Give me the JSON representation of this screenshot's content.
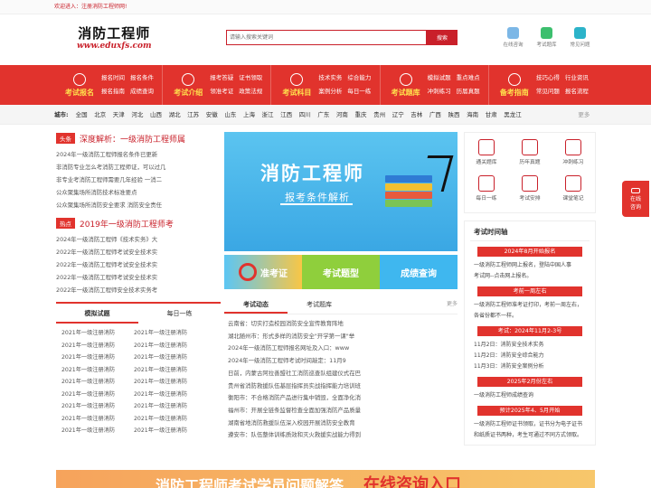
{
  "topbar": {
    "welcome": "欢迎进入：注册消防工程师网!"
  },
  "logo": {
    "cn": "消防工程师",
    "url": "www.eduxfs.com"
  },
  "search": {
    "placeholder": "请输入搜索关键词",
    "button": "搜索"
  },
  "quick": [
    {
      "label": "在线咨询",
      "color": "#7cb7e6"
    },
    {
      "label": "考试题库",
      "color": "#3dbf6e"
    },
    {
      "label": "常见问题",
      "color": "#2cb3c9"
    }
  ],
  "nav": [
    {
      "label": "考试报名",
      "links": [
        [
          "报名时间",
          "报名条件"
        ],
        [
          "报名指南",
          "成绩查询"
        ]
      ]
    },
    {
      "label": "考试介绍",
      "links": [
        [
          "报考答疑",
          "证书领取"
        ],
        [
          "领准考证",
          "政策法规"
        ]
      ]
    },
    {
      "label": "考试科目",
      "links": [
        [
          "技术实务",
          "综合能力"
        ],
        [
          "案例分析",
          "每日一练"
        ]
      ]
    },
    {
      "label": "考试题库",
      "links": [
        [
          "模拟试题",
          "重点难点"
        ],
        [
          "冲刺练习",
          "历届真题"
        ]
      ]
    },
    {
      "label": "备考指南",
      "links": [
        [
          "技巧心得",
          "行业资讯"
        ],
        [
          "常见问题",
          "报名流程"
        ]
      ]
    }
  ],
  "cities": {
    "label": "城市:",
    "items": [
      "全国",
      "北京",
      "天津",
      "河北",
      "山西",
      "湖北",
      "江苏",
      "安徽",
      "山东",
      "上海",
      "浙江",
      "江西",
      "四川",
      "广东",
      "河南",
      "重庆",
      "贵州",
      "辽宁",
      "吉林",
      "广西",
      "陕西",
      "海南",
      "甘肃",
      "黑龙江"
    ],
    "more": "更多"
  },
  "headline": {
    "tag": "头条",
    "title": "深度解析：一级消防工程师属",
    "items": [
      "2024年一级消防工程师报名条件已更新",
      "非消防专业怎么考消防工程师证，可以过几",
      "非专业考消防工程师需要几年经验 一消二",
      "公众聚集场所消防技术标准要点",
      "公众聚集场所消防安全要求 消防安全责任"
    ]
  },
  "hot": {
    "tag": "热点",
    "title": "2019年一级消防工程师考",
    "items": [
      "2024年一级消防工程师《技术实务》大",
      "2022年一级消防工程师考试安全技术实",
      "2022年一级消防工程师考试安全技术实",
      "2022年一级消防工程师考试安全技术实",
      "2022年一级消防工程师安全技术实务考"
    ]
  },
  "practice": {
    "tabs": [
      "模拟试题",
      "每日一练"
    ],
    "items": [
      "2021年一级注册消防",
      "2021年一级注册消防",
      "2021年一级注册消防",
      "2021年一级注册消防",
      "2021年一级注册消防",
      "2021年一级注册消防",
      "2021年一级注册消防",
      "2021年一级注册消防",
      "2021年一级注册消防",
      "2021年一级注册消防",
      "2021年一级注册消防",
      "2021年一级注册消防",
      "2021年一级注册消防",
      "2021年一级注册消防",
      "2021年一级注册消防",
      "2021年一级注册消防",
      "2021年一级注册消防",
      "2021年一级注册消防"
    ]
  },
  "banner": {
    "title": "消防工程师",
    "subtitle": "报考条件解析"
  },
  "mods": [
    "准考证",
    "考试题型",
    "成绩查询"
  ],
  "newsTabs": {
    "tabs": [
      "考试动态",
      "考试题库"
    ],
    "more": "更多"
  },
  "news": [
    "云南省：切实打造校园消防安全宣传教育阵地",
    "湖北随州市：形式多样的消防安全\"开学第一课\"举",
    "2024年一级消防工程师报名网址及入口：www",
    "2024年一级消防工程师考试时间敲定：11月9",
    "日前，内蒙古阿拉善盟社工消防巡查队组建仪式在巴",
    "贵州省消防救援队伍基层指挥员实战指挥能力培训班",
    "衡阳市：不合格消防产品进行集中销毁，全面净化消",
    "福州市：开展全链条监督检查全面加强消防产品质量",
    "湖南省地消防救援队伍深入校园开展消防安全教育",
    "遵安市：队伍整体训练质效和灭火救援实战能力得到"
  ],
  "iconGrid": [
    "通关题库",
    "历年真题",
    "冲刺练习",
    "每日一练",
    "考试安排",
    "课堂笔记"
  ],
  "timeline": {
    "title": "考试时间轴",
    "entries": [
      {
        "head": "2024年8月开始报名",
        "lines": [
          "一级消防工程师网上报名，登陆中国人事",
          "考试网--点击网上报名。"
        ]
      },
      {
        "head": "考前一周左右",
        "lines": [
          "一级消防工程师准考证打印，考前一周左右，",
          "各省份都不一样。"
        ]
      },
      {
        "head": "考试：2024年11月2-3号",
        "lines": [
          "11月2日：消防安全技术实务",
          "11月2日：消防安全综合能力",
          "11月3日：消防安全案例分析"
        ]
      },
      {
        "head": "2025年2月份左右",
        "lines": [
          "一级消防工程师成绩查询"
        ]
      },
      {
        "head": "预计2025年4、5月开始",
        "lines": [
          "一级消防工程师证书领取，证书分为电子证书",
          "和纸质证书两种，考生可通过不同方式领取。"
        ]
      }
    ]
  },
  "float": {
    "label1": "在线",
    "label2": "咨询"
  },
  "bottomBanner": {
    "left": "消防工程师考试学员问题解答",
    "right": "在线咨询入口"
  }
}
